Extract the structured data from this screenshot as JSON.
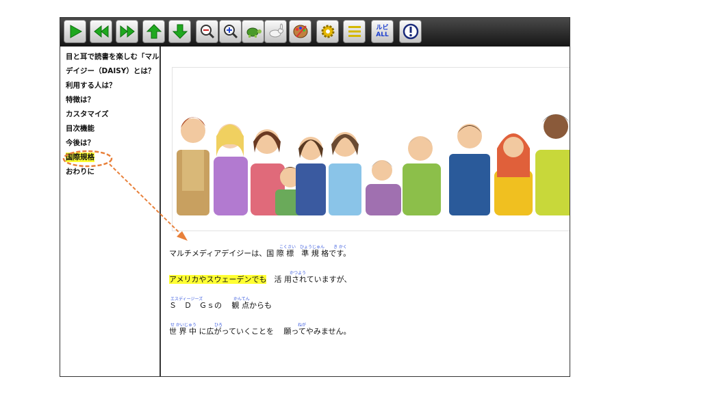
{
  "toolbar": {
    "buttons": [
      {
        "name": "play-button",
        "icon": "play-icon",
        "label": ""
      },
      {
        "name": "previous-button",
        "icon": "double-left-icon",
        "label": ""
      },
      {
        "name": "next-button",
        "icon": "double-right-icon",
        "label": ""
      },
      {
        "name": "up-button",
        "icon": "arrow-up-icon",
        "label": ""
      },
      {
        "name": "down-button",
        "icon": "arrow-down-icon",
        "label": ""
      },
      {
        "name": "zoom-out-button",
        "icon": "zoom-out-icon",
        "label": ""
      },
      {
        "name": "zoom-in-button",
        "icon": "zoom-in-icon",
        "label": ""
      },
      {
        "name": "slow-button",
        "icon": "turtle-icon",
        "label": ""
      },
      {
        "name": "fast-button",
        "icon": "rabbit-icon",
        "label": ""
      },
      {
        "name": "color-button",
        "icon": "palette-icon",
        "label": ""
      },
      {
        "name": "settings-button",
        "icon": "gear-icon",
        "label": ""
      },
      {
        "name": "menu-button",
        "icon": "menu-icon",
        "label": ""
      },
      {
        "name": "ruby-button",
        "icon": "ruby-icon",
        "label": "ルビ ALL"
      },
      {
        "name": "info-button",
        "icon": "exclamation-icon",
        "label": ""
      }
    ],
    "ruby_label_top": "ルビ",
    "ruby_label_bottom": "ALL"
  },
  "sidebar": {
    "items": [
      {
        "label": "目と耳で読書を楽しむ「マル"
      },
      {
        "label": "デイジー（DAISY）とは？"
      },
      {
        "label": "利用する人は？"
      },
      {
        "label": "特徴は？"
      },
      {
        "label": "カスタマイズ"
      },
      {
        "label": "目次機能"
      },
      {
        "label": "今後は？"
      },
      {
        "label": "国際規格",
        "active": true
      },
      {
        "label": "おわりに"
      }
    ]
  },
  "content": {
    "lines": [
      {
        "text": "マルチメディアデイジーは、国 際 標　準 規 格です。",
        "highlight": ""
      },
      {
        "text": "　活 用されていますが、",
        "highlight": "アメリカやスウェーデンでも"
      },
      {
        "text": "Ｓ　Ｄ　Ｇｓの　 観 点からも",
        "highlight": ""
      },
      {
        "text": "世 界  中 に広がっていくことを　 願ってやみません。",
        "highlight": ""
      }
    ],
    "ruby": {
      "kokusai": "こくさい",
      "hyoujun": "ひょうじゅん",
      "kikaku": "き かく",
      "katsuyou": "かつよう",
      "sdgs": "エスディージーズ",
      "kanten": "かんてん",
      "sekaijuu": "せ かいじゅう",
      "hiro": "ひろ",
      "nega": "ねが"
    }
  },
  "colors": {
    "toolbar_green": "#1fa81f",
    "highlight": "#ffff33",
    "annotation_orange": "#e8803a",
    "ruby_blue": "#3355dd"
  }
}
